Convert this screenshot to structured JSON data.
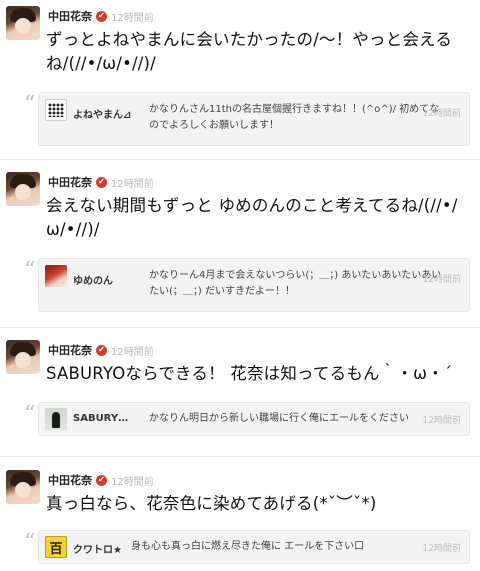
{
  "posts": [
    {
      "name": "中田花奈",
      "time": "12時間前",
      "message": "ずっとよねやまんに会いたかったの/〜！やっと会えるね/(//•/ω/•//)/",
      "reply": {
        "avatar_icon": "dotted-avatar-icon",
        "name": "よねやまん⊿",
        "text": "かなりんさん11thの名古屋個握行きますね！！(^o^)/ 初めてなのでよろしくお願いします！",
        "time": "12時間前"
      }
    },
    {
      "name": "中田花奈",
      "time": "12時間前",
      "message": "会えない期間もずっと ゆめのんのこと考えてるね/(//•/ω/•//)/",
      "reply": {
        "avatar_icon": "red-hair-avatar-icon",
        "name": "ゆめのん",
        "text": "かなりーん4月まで会えないつらい(；＿；) あいたいあいたいあいたい(；＿；) だいすきだよー！！",
        "time": "12時間前"
      }
    },
    {
      "name": "中田花奈",
      "time": "12時間前",
      "message": "SABURYOならできる！ 花奈は知ってるもん｀・ω・´",
      "reply": {
        "avatar_icon": "figure-avatar-icon",
        "name": "SABURY…",
        "text": "かなりん明日から新しい職場に行く俺にエールをください",
        "time": "12時間前"
      }
    },
    {
      "name": "中田花奈",
      "time": "12時間前",
      "message": "真っ白なら、花奈色に染めてあげる(*ˇ︶ˇ*)",
      "reply": {
        "avatar_icon": "kanji-avatar-icon",
        "avatar_char": "百",
        "name": "クワトロ★",
        "text": "身も心も真っ白に燃え尽きた俺に エールを下さい口",
        "time": "12時間前"
      }
    }
  ],
  "verified_mark": "✔",
  "quote_mark": "“",
  "colors": {
    "verified": "#d23b2f",
    "time": "#b9b9b9",
    "reply_bg": "#f3f3f3",
    "divider": "#e6e6e6"
  }
}
